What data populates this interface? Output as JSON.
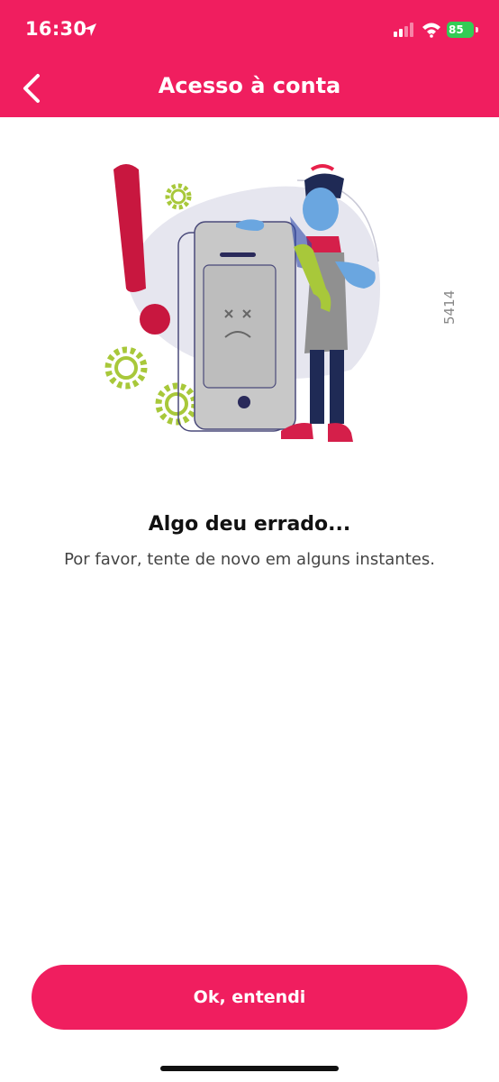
{
  "status_bar": {
    "time": "16:30",
    "battery": "85"
  },
  "nav": {
    "title": "Acesso à conta",
    "back_icon": "chevron-left-icon"
  },
  "illustration": {
    "code": "5414"
  },
  "message": {
    "title": "Algo deu errado...",
    "subtitle": "Por favor, tente de novo em alguns instantes."
  },
  "actions": {
    "ok_label": "Ok, entendi"
  },
  "colors": {
    "brand": "#f01e5f",
    "accent_green": "#a8c83a",
    "battery": "#33cc55"
  }
}
